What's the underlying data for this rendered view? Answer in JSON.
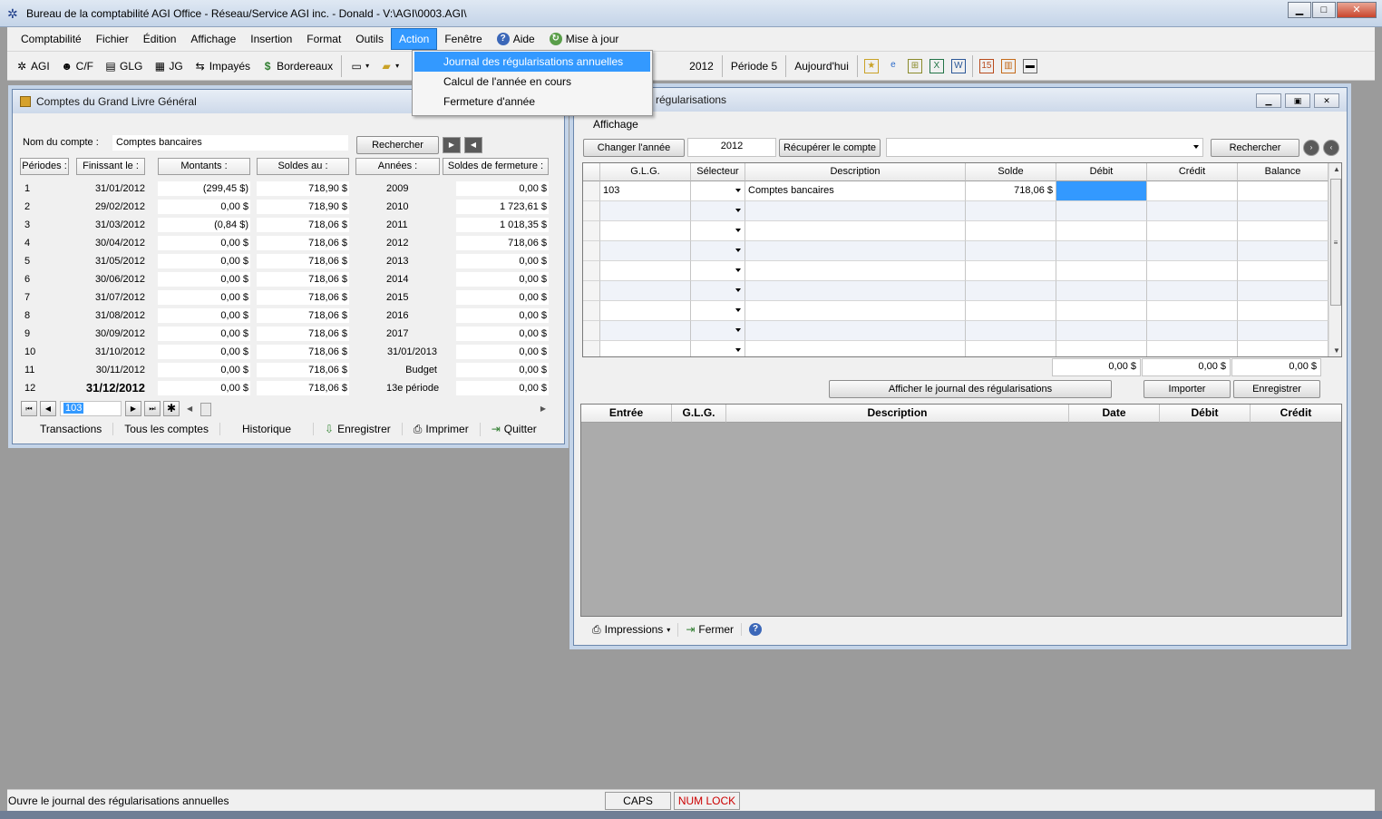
{
  "window": {
    "title": "Bureau de la comptabilité AGI Office - Réseau/Service AGI inc. - Donald - V:\\AGI\\0003.AGI\\"
  },
  "menu": {
    "items": [
      "Comptabilité",
      "Fichier",
      "Édition",
      "Affichage",
      "Insertion",
      "Format",
      "Outils",
      "Action",
      "Fenêtre",
      "Aide",
      "Mise à jour"
    ],
    "active": "Action"
  },
  "action_menu": {
    "items": [
      "Journal des régularisations annuelles",
      "Calcul de l'année en cours",
      "Fermeture d'année"
    ]
  },
  "toolbar": {
    "agi": "AGI",
    "cf": "C/F",
    "glg": "GLG",
    "jg": "JG",
    "impayes": "Impayés",
    "bordereaux": "Bordereaux",
    "year_tail": "2012",
    "periode": "Période 5",
    "aujourdhui": "Aujourd'hui"
  },
  "ledger": {
    "title": "Comptes du Grand Livre Général",
    "account_label": "Nom du compte :",
    "account_value": "Comptes bancaires",
    "search_button": "Rechercher",
    "headers": [
      "Périodes :",
      "Finissant le :",
      "Montants :",
      "Soldes au :",
      "Années :",
      "Soldes de fermeture :"
    ],
    "rows": [
      [
        "1",
        "31/01/2012",
        "(299,45 $)",
        "718,90 $",
        "2009",
        "0,00 $"
      ],
      [
        "2",
        "29/02/2012",
        "0,00 $",
        "718,90 $",
        "2010",
        "1 723,61 $"
      ],
      [
        "3",
        "31/03/2012",
        "(0,84 $)",
        "718,06 $",
        "2011",
        "1 018,35 $"
      ],
      [
        "4",
        "30/04/2012",
        "0,00 $",
        "718,06 $",
        "2012",
        "718,06 $"
      ],
      [
        "5",
        "31/05/2012",
        "0,00 $",
        "718,06 $",
        "2013",
        "0,00 $"
      ],
      [
        "6",
        "30/06/2012",
        "0,00 $",
        "718,06 $",
        "2014",
        "0,00 $"
      ],
      [
        "7",
        "31/07/2012",
        "0,00 $",
        "718,06 $",
        "2015",
        "0,00 $"
      ],
      [
        "8",
        "31/08/2012",
        "0,00 $",
        "718,06 $",
        "2016",
        "0,00 $"
      ],
      [
        "9",
        "30/09/2012",
        "0,00 $",
        "718,06 $",
        "2017",
        "0,00 $"
      ],
      [
        "10",
        "31/10/2012",
        "0,00 $",
        "718,06 $",
        "31/01/2013",
        "0,00 $"
      ],
      [
        "11",
        "30/11/2012",
        "0,00 $",
        "718,06 $",
        "Budget",
        "0,00 $"
      ],
      [
        "12",
        "31/12/2012",
        "0,00 $",
        "718,06 $",
        "13e période",
        "0,00 $"
      ]
    ],
    "record_value": "103",
    "bottom": [
      "Transactions",
      "Tous les comptes",
      "Historique",
      "Enregistrer",
      "Imprimer",
      "Quitter"
    ]
  },
  "journal": {
    "title": "régularisations",
    "menu_label": "Affichage",
    "change_year_button": "Changer l'année",
    "year_value": "2012",
    "recover_button": "Récupérer le compte",
    "search_button": "Rechercher",
    "columns": [
      "G.L.G.",
      "Sélecteur",
      "Description",
      "Solde",
      "Débit",
      "Crédit",
      "Balance"
    ],
    "first_row": {
      "glg": "103",
      "description": "Comptes bancaires",
      "solde": "718,06 $"
    },
    "totals": [
      "0,00 $",
      "0,00 $",
      "0,00 $"
    ],
    "show_journal_button": "Afficher le journal des régularisations",
    "import_button": "Importer",
    "save_button": "Enregistrer",
    "entries_columns": [
      "Entrée",
      "G.L.G.",
      "Description",
      "Date",
      "Débit",
      "Crédit"
    ],
    "print_button": "Impressions",
    "close_button": "Fermer"
  },
  "status": {
    "message": "Ouvre le journal des régularisations annuelles",
    "caps": "CAPS",
    "numlock": "NUM LOCK",
    "numlock_color": "#cc0000"
  }
}
